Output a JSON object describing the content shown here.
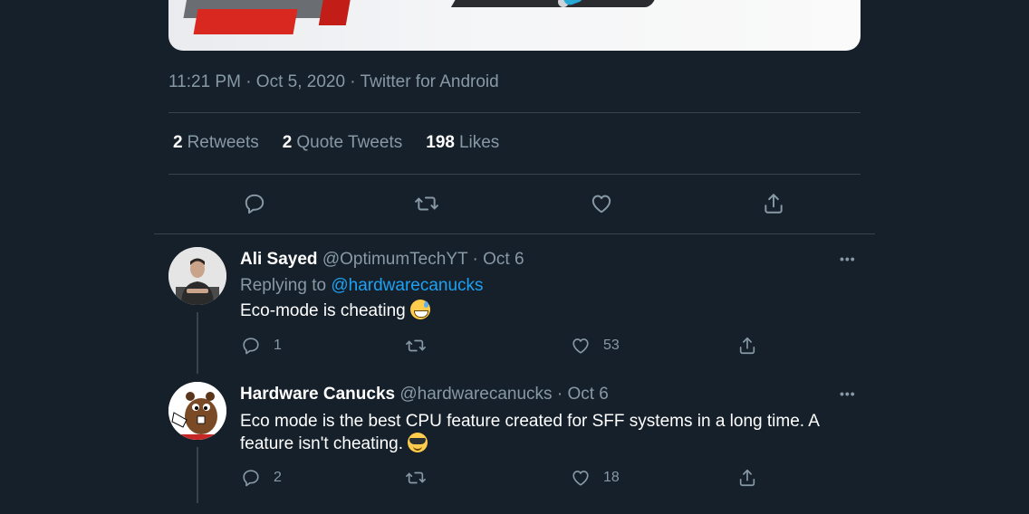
{
  "tweet": {
    "meta": "11:21 PM · Oct 5, 2020 · Twitter for Android",
    "stats": [
      {
        "count": "2",
        "label": "Retweets"
      },
      {
        "count": "2",
        "label": "Quote Tweets"
      },
      {
        "count": "198",
        "label": "Likes"
      }
    ]
  },
  "replies": [
    {
      "display_name": "Ali Sayed",
      "handle_date": "@OptimumTechYT · Oct 6",
      "replying_prefix": "Replying to",
      "replying_handle": "@hardwarecanucks",
      "text": "Eco-mode is cheating",
      "emoji": "sweat-smile",
      "reply_count": "1",
      "retweet_count": "",
      "like_count": "53"
    },
    {
      "display_name": "Hardware Canucks",
      "handle_date": "@hardwarecanucks · Oct 6",
      "text_line1": "Eco mode is the best CPU feature created for SFF systems in a long time. A",
      "text_line2": "feature isn't cheating.",
      "emoji": "sunglasses",
      "reply_count": "2",
      "retweet_count": "",
      "like_count": "18"
    }
  ],
  "more_label": "•••",
  "colors": {
    "background": "#15202b",
    "secondary_text": "#8899a6",
    "link": "#1da1f2",
    "divider": "#38444d"
  }
}
